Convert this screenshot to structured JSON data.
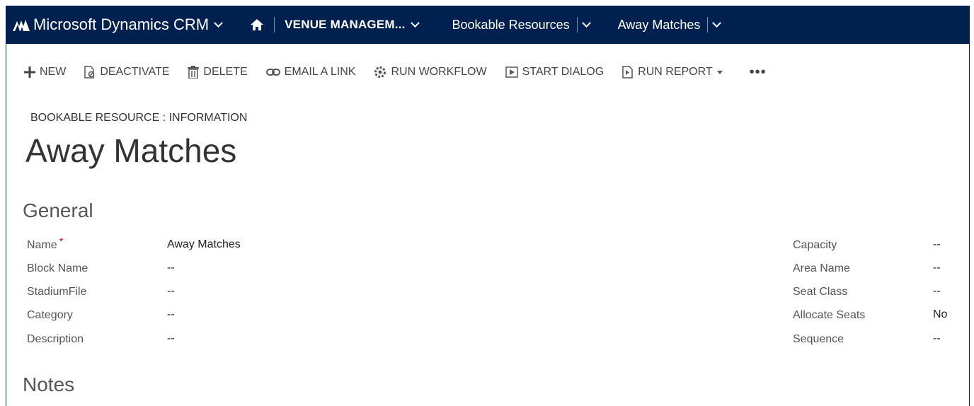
{
  "nav": {
    "app_title": "Microsoft Dynamics CRM",
    "area": "VENUE MANAGEM...",
    "crumbs": [
      "Bookable Resources",
      "Away Matches"
    ]
  },
  "commands": {
    "new": "NEW",
    "deactivate": "DEACTIVATE",
    "delete": "DELETE",
    "email_link": "EMAIL A LINK",
    "run_workflow": "RUN WORKFLOW",
    "start_dialog": "START DIALOG",
    "run_report": "RUN REPORT",
    "more": "•••"
  },
  "header": {
    "entity_type": "BOOKABLE RESOURCE : INFORMATION",
    "title": "Away Matches"
  },
  "sections": {
    "general": "General",
    "notes": "Notes"
  },
  "fields_left": [
    {
      "label": "Name",
      "value": "Away Matches",
      "required": "*"
    },
    {
      "label": "Block Name",
      "value": "--"
    },
    {
      "label": "StadiumFile",
      "value": "--"
    },
    {
      "label": "Category",
      "value": "--"
    },
    {
      "label": "Description",
      "value": "--"
    }
  ],
  "fields_right": [
    {
      "label": "Capacity",
      "value": "--"
    },
    {
      "label": "Area Name",
      "value": "--"
    },
    {
      "label": "Seat Class",
      "value": "--"
    },
    {
      "label": "Allocate Seats",
      "value": "No"
    },
    {
      "label": "Sequence",
      "value": "--"
    }
  ],
  "colors": {
    "nav_background": "#002050",
    "required_marker": "#e00000"
  }
}
